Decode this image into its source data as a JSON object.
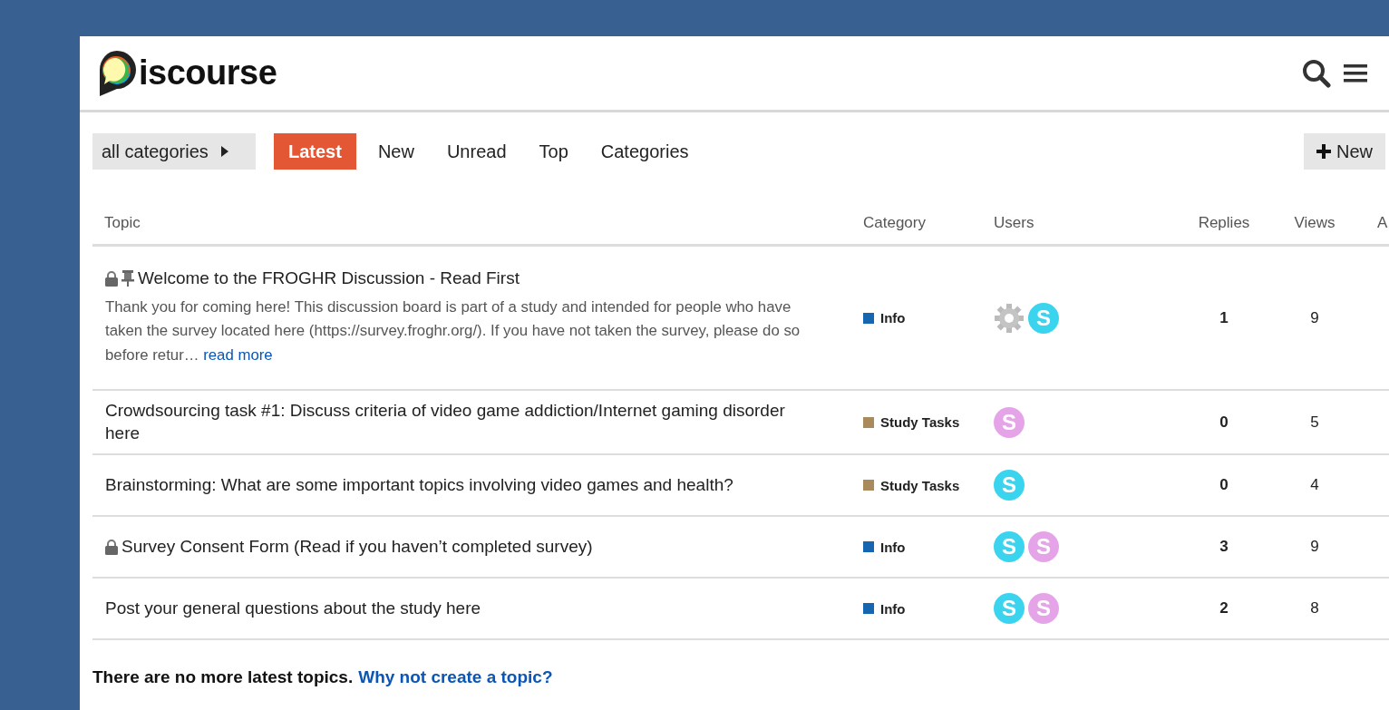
{
  "header": {
    "logo_text": "iscourse"
  },
  "nav": {
    "category_dropdown": "all categories",
    "tabs": [
      {
        "label": "Latest",
        "selected": true
      },
      {
        "label": "New",
        "selected": false
      },
      {
        "label": "Unread",
        "selected": false
      },
      {
        "label": "Top",
        "selected": false
      },
      {
        "label": "Categories",
        "selected": false
      }
    ],
    "new_topic_button": "New"
  },
  "table": {
    "columns": [
      "Topic",
      "Category",
      "Users",
      "Replies",
      "Views",
      "A"
    ],
    "rows": [
      {
        "title": "Welcome to the FROGHR Discussion - Read First",
        "locked": true,
        "pinned": true,
        "excerpt": "Thank you for coming here! This discussion board is part of a study and intended for people who have taken the survey located here (https://survey.froghr.org/). If you have not taken the survey, please do so before retur…",
        "read_more": "read more",
        "category": {
          "name": "Info",
          "color": "#1565b0"
        },
        "users": [
          {
            "kind": "gear"
          },
          {
            "kind": "letter",
            "letter": "S",
            "color": "#3ad4ef"
          }
        ],
        "replies": "1",
        "views": "9"
      },
      {
        "title": "Crowdsourcing task #1: Discuss criteria of video game addiction/Internet gaming disorder here",
        "locked": false,
        "pinned": false,
        "category": {
          "name": "Study Tasks",
          "color": "#a88a5c"
        },
        "users": [
          {
            "kind": "letter",
            "letter": "S",
            "color": "#e6a4e8"
          }
        ],
        "replies": "0",
        "views": "5"
      },
      {
        "title": "Brainstorming: What are some important topics involving video games and health?",
        "locked": false,
        "pinned": false,
        "category": {
          "name": "Study Tasks",
          "color": "#a88a5c"
        },
        "users": [
          {
            "kind": "letter",
            "letter": "S",
            "color": "#3ad4ef"
          }
        ],
        "replies": "0",
        "views": "4"
      },
      {
        "title": "Survey Consent Form (Read if you haven’t completed survey)",
        "locked": true,
        "pinned": false,
        "category": {
          "name": "Info",
          "color": "#1565b0"
        },
        "users": [
          {
            "kind": "letter",
            "letter": "S",
            "color": "#3ad4ef"
          },
          {
            "kind": "letter",
            "letter": "S",
            "color": "#e6a4e8"
          }
        ],
        "replies": "3",
        "views": "9"
      },
      {
        "title": "Post your general questions about the study here",
        "locked": false,
        "pinned": false,
        "category": {
          "name": "Info",
          "color": "#1565b0"
        },
        "users": [
          {
            "kind": "letter",
            "letter": "S",
            "color": "#3ad4ef"
          },
          {
            "kind": "letter",
            "letter": "S",
            "color": "#e6a4e8"
          }
        ],
        "replies": "2",
        "views": "8"
      }
    ]
  },
  "footer": {
    "message": "There are no more latest topics.",
    "link": "Why not create a topic?"
  }
}
